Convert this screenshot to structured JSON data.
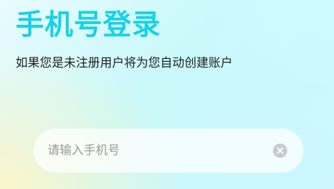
{
  "header": {
    "title": "手机号登录",
    "subtitle": "如果您是未注册用户将为您自动创建账户"
  },
  "phone_input": {
    "value": "",
    "placeholder": "请输入手机号",
    "clear_icon": "close-circle-icon"
  },
  "colors": {
    "title": "#19d2e6",
    "subtitle": "#1f1f1f",
    "placeholder": "#9a9a9a",
    "clear_icon": "#c7cbd0"
  }
}
